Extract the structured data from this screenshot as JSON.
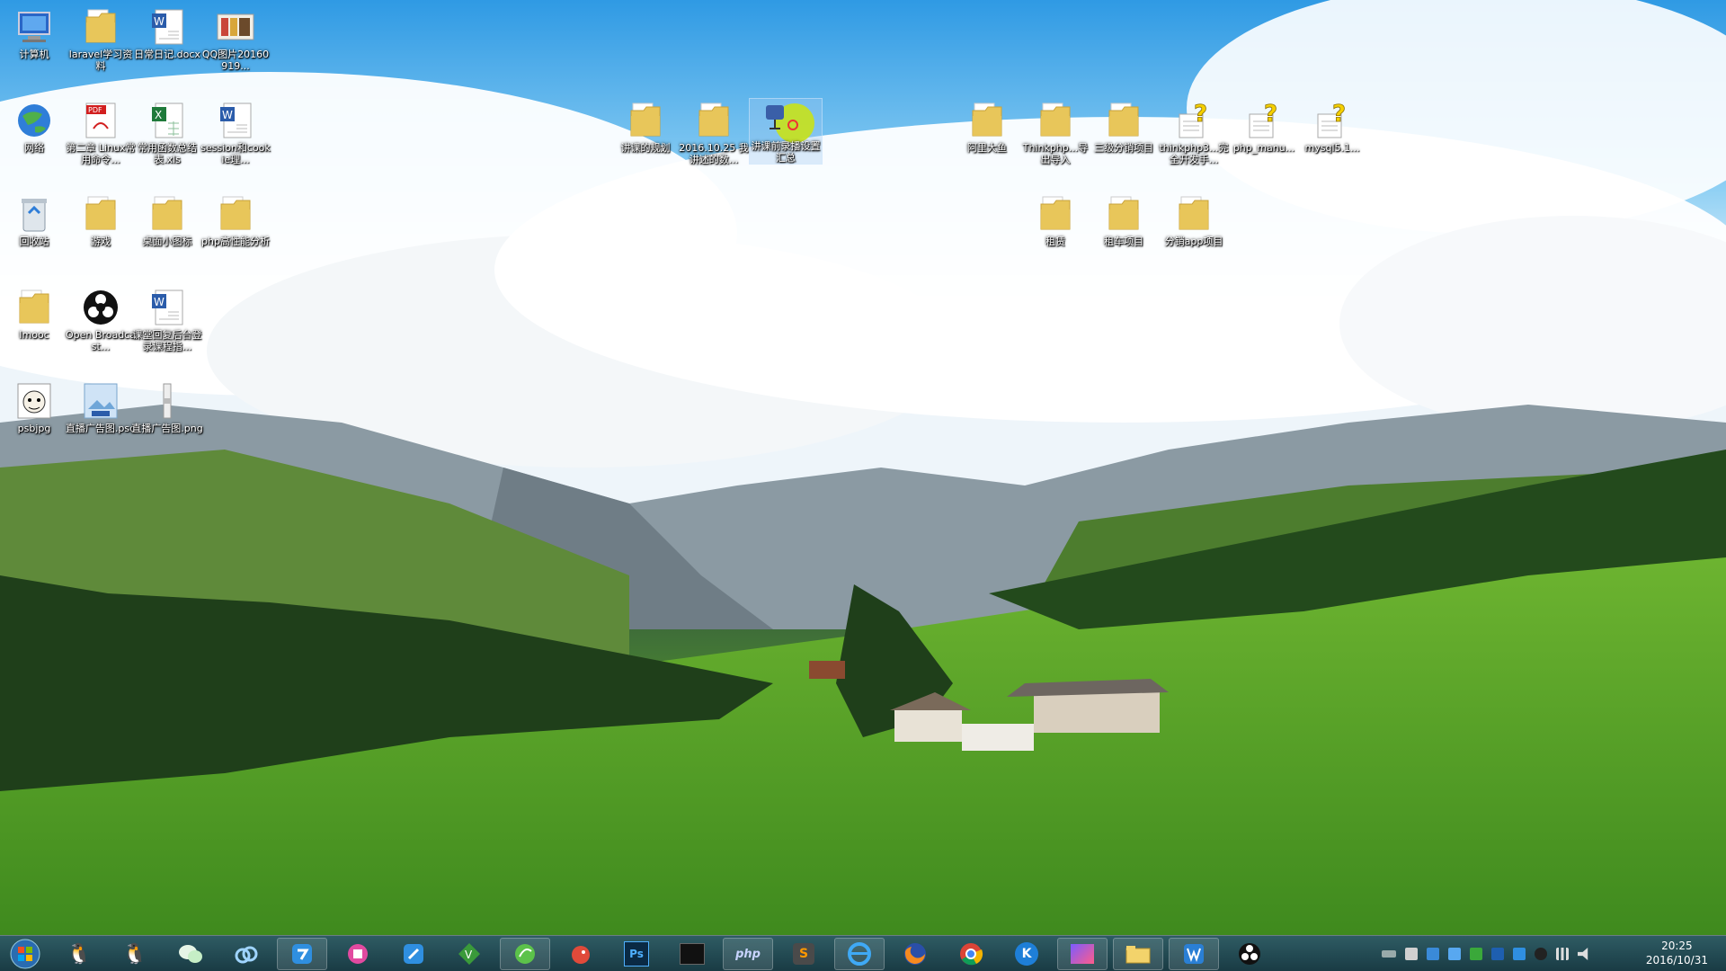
{
  "colors": {
    "folder": "#e8c65a",
    "folder_dark": "#c9a23a",
    "word": "#2b5caa",
    "excel": "#1f7a3a",
    "pdf": "#d21f1f",
    "taskbar": "#1c3a4e",
    "label_text": "#ffffff"
  },
  "desktop": {
    "icons": [
      {
        "id": "computer",
        "label": "计算机",
        "icon": "computer-icon"
      },
      {
        "id": "laravel",
        "label": "laravel学习资料",
        "icon": "folder-icon"
      },
      {
        "id": "daily-notes",
        "label": "日常日记.docx",
        "icon": "word-doc-icon"
      },
      {
        "id": "qq-pic",
        "label": "QQ图片20160919...",
        "icon": "image-file-icon"
      },
      {
        "id": "network",
        "label": "网络",
        "icon": "network-globe-icon"
      },
      {
        "id": "linux-pdf",
        "label": "第二章 Linux常用命令...",
        "icon": "pdf-icon"
      },
      {
        "id": "functions-xls",
        "label": "常用函数总结表.xls",
        "icon": "excel-icon"
      },
      {
        "id": "session-doc",
        "label": "session和cookie理...",
        "icon": "word-doc-icon"
      },
      {
        "id": "recycle",
        "label": "回收站",
        "icon": "recycle-bin-icon"
      },
      {
        "id": "games",
        "label": "游戏",
        "icon": "folder-icon"
      },
      {
        "id": "desktop-small",
        "label": "桌面小图标",
        "icon": "folder-icon"
      },
      {
        "id": "php-perf",
        "label": "php高性能分析",
        "icon": "folder-icon"
      },
      {
        "id": "imooc",
        "label": "Imooc",
        "icon": "folder-icon"
      },
      {
        "id": "obs",
        "label": "Open Broadcast...",
        "icon": "obs-icon"
      },
      {
        "id": "lesson-doc",
        "label": "课堂回复后台登录课程指...",
        "icon": "word-doc-icon"
      },
      {
        "id": "psbjpg",
        "label": "psbjpg",
        "icon": "face-image-icon"
      },
      {
        "id": "live-psd",
        "label": "直播广告图.psd",
        "icon": "psd-file-icon"
      },
      {
        "id": "live-png",
        "label": "直播广告图.png",
        "icon": "png-file-icon"
      },
      {
        "id": "lecture-plan",
        "label": "讲课的规划",
        "icon": "folder-icon"
      },
      {
        "id": "date-folder",
        "label": "2016.10.25 我讲述的数...",
        "icon": "folder-icon"
      },
      {
        "id": "lecture-record",
        "label": "讲课前录播设置汇总",
        "icon": "recorder-icon"
      },
      {
        "id": "aliyun",
        "label": "阿里大鱼",
        "icon": "folder-icon"
      },
      {
        "id": "thinkphp-import",
        "label": "Thinkphp...导出导入",
        "icon": "folder-icon"
      },
      {
        "id": "three-level",
        "label": "三级分销项目",
        "icon": "folder-icon"
      },
      {
        "id": "thinkphp-manual",
        "label": "thinkphp3...完全开发手...",
        "icon": "help-doc-icon"
      },
      {
        "id": "php-manual",
        "label": "php_manu...",
        "icon": "help-doc-icon"
      },
      {
        "id": "mysql-manual",
        "label": "mysql5.1...",
        "icon": "help-doc-icon"
      },
      {
        "id": "rent",
        "label": "租赁",
        "icon": "folder-icon"
      },
      {
        "id": "rental-project",
        "label": "租车项目",
        "icon": "folder-icon"
      },
      {
        "id": "app-project",
        "label": "分销app项目",
        "icon": "folder-icon"
      }
    ]
  },
  "taskbar": {
    "start": {
      "icon": "windows-start-icon"
    },
    "apps": [
      {
        "id": "qq",
        "icon": "qq-penguin-icon"
      },
      {
        "id": "qq2",
        "icon": "qq-penguin-color-icon"
      },
      {
        "id": "wechat",
        "icon": "wechat-icon"
      },
      {
        "id": "baidu-netdisk",
        "icon": "cloud-sync-icon"
      },
      {
        "id": "app-blue",
        "icon": "app-blue-icon"
      },
      {
        "id": "app-pink",
        "icon": "app-pink-icon"
      },
      {
        "id": "notes",
        "icon": "pen-note-icon"
      },
      {
        "id": "vim",
        "icon": "vim-icon"
      },
      {
        "id": "app-green",
        "icon": "green-leaf-icon"
      },
      {
        "id": "bird",
        "icon": "red-bird-icon"
      },
      {
        "id": "photoshop",
        "label": "Ps",
        "icon": "photoshop-icon"
      },
      {
        "id": "terminal",
        "icon": "terminal-icon"
      },
      {
        "id": "phpstudy",
        "label": "php",
        "icon": "php-icon"
      },
      {
        "id": "sublime",
        "label": "S",
        "icon": "sublime-icon"
      },
      {
        "id": "ie",
        "icon": "ie-icon"
      },
      {
        "id": "firefox",
        "icon": "firefox-icon"
      },
      {
        "id": "chrome",
        "icon": "chrome-icon"
      },
      {
        "id": "kugou",
        "label": "K",
        "icon": "kugou-icon"
      },
      {
        "id": "phpstorm",
        "icon": "phpstorm-icon"
      },
      {
        "id": "explorer",
        "icon": "folder-explorer-icon"
      },
      {
        "id": "wps",
        "icon": "wps-writer-icon"
      },
      {
        "id": "obs",
        "icon": "obs-icon"
      }
    ],
    "tray": {
      "icons": [
        "keyboard-icon",
        "app-tray-icon",
        "shield-icon",
        "qq-tray-icon",
        "green-tray-icon",
        "blue-tray-icon",
        "pen-tray-icon",
        "qq-penguin-tray-icon",
        "speaker-icon",
        "network-signal-icon"
      ],
      "time": "20:25",
      "date": "2016/10/31"
    }
  }
}
